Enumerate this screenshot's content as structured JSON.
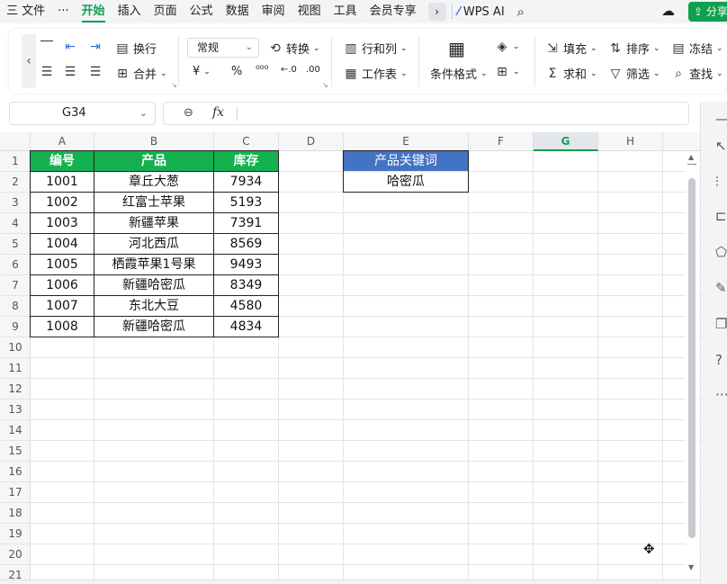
{
  "menubar": {
    "items": [
      {
        "label": "三 文件",
        "active": false
      },
      {
        "label": "···",
        "active": false
      },
      {
        "label": "开始",
        "active": true
      },
      {
        "label": "插入",
        "active": false
      },
      {
        "label": "页面",
        "active": false
      },
      {
        "label": "公式",
        "active": false
      },
      {
        "label": "数据",
        "active": false
      },
      {
        "label": "审阅",
        "active": false
      },
      {
        "label": "视图",
        "active": false
      },
      {
        "label": "工具",
        "active": false
      },
      {
        "label": "会员专享",
        "active": false
      }
    ],
    "more_icon": "›",
    "wps_ai_label": "WPS AI",
    "share_label": "分享",
    "accent_color": "#10a050"
  },
  "ribbon": {
    "wrap_label": "换行",
    "merge_label": "合并",
    "number_format": "常规",
    "convert_label": "转换",
    "rowcol_label": "行和列",
    "worksheet_label": "工作表",
    "condfmt_label": "条件格式",
    "fill_label": "填充",
    "sort_label": "排序",
    "freeze_label": "冻结",
    "sum_label": "求和",
    "filter_label": "筛选",
    "find_label": "查找",
    "currency_symbol": "¥",
    "percent_symbol": "%",
    "thousands_symbol": "⁰⁰⁰"
  },
  "formula": {
    "namebox": "G34",
    "fx": "fx",
    "content": ""
  },
  "sheet": {
    "columns": [
      "A",
      "B",
      "C",
      "D",
      "E",
      "F",
      "G",
      "H"
    ],
    "selected_column": "G",
    "rows": [
      "1",
      "2",
      "3",
      "4",
      "5",
      "6",
      "7",
      "8",
      "9",
      "10",
      "11",
      "12",
      "13",
      "14",
      "15",
      "16",
      "17",
      "18",
      "19",
      "20",
      "21"
    ],
    "table_header": [
      "编号",
      "产品",
      "库存"
    ],
    "table_rows": [
      [
        "1001",
        "章丘大葱",
        "7934"
      ],
      [
        "1002",
        "红富士苹果",
        "5193"
      ],
      [
        "1003",
        "新疆苹果",
        "7391"
      ],
      [
        "1004",
        "河北西瓜",
        "8569"
      ],
      [
        "1005",
        "栖霞苹果1号果",
        "9493"
      ],
      [
        "1006",
        "新疆哈密瓜",
        "8349"
      ],
      [
        "1007",
        "东北大豆",
        "4580"
      ],
      [
        "1008",
        "新疆哈密瓜",
        "4834"
      ]
    ],
    "keyword_header": "产品关键词",
    "keyword_value": "哈密瓜",
    "header_green": "#15b150",
    "header_blue": "#4472c4"
  }
}
